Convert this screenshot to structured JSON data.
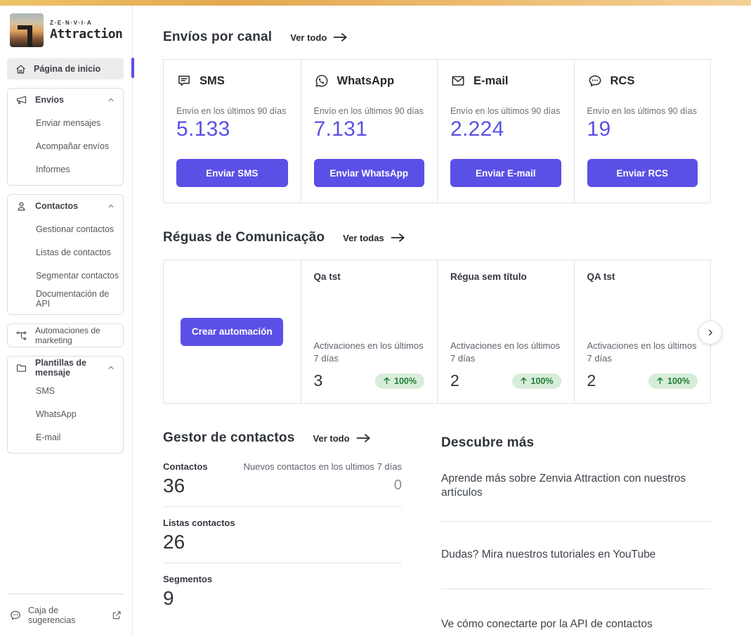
{
  "topbar": {
    "gradient": [
      "#eec369",
      "#e3a84f",
      "#ecba6e",
      "#f4d096"
    ]
  },
  "sidebar": {
    "logo": {
      "brand_small": "Z·E·N·V·I·A",
      "brand_large": "Attraction"
    },
    "home": {
      "label": "Página de inicio",
      "icon": "home-icon"
    },
    "groups": [
      {
        "label": "Envíos",
        "icon": "megaphone-icon",
        "children": [
          "Enviar mensajes",
          "Acompañar envíos",
          "Informes"
        ]
      },
      {
        "label": "Contactos",
        "icon": "person-icon",
        "children": [
          "Gestionar contactos",
          "Listas de contactos",
          "Segmentar contactos",
          "Documentación de API"
        ]
      },
      {
        "label": "Automaciones de marketing",
        "icon": "flow-branch-icon",
        "children": []
      },
      {
        "label": "Plantillas de mensaje",
        "icon": "folder-icon",
        "children": [
          "SMS",
          "WhatsApp",
          "E-mail"
        ]
      }
    ],
    "footer": {
      "label": "Caja de sugerencias",
      "icon": "chat-bubble-dots-icon",
      "action_icon": "external-link-icon"
    }
  },
  "channels": {
    "title": "Envíos por canal",
    "link_label": "Ver todo",
    "cards": [
      {
        "name": "SMS",
        "icon": "sms-message-icon",
        "metric_label": "Envío en los últimos 90 días",
        "value": "5.133",
        "button_label": "Enviar SMS"
      },
      {
        "name": "WhatsApp",
        "icon": "whatsapp-icon",
        "metric_label": "Envío en los últimos 90 días",
        "value": "7.131",
        "button_label": "Enviar WhatsApp"
      },
      {
        "name": "E-mail",
        "icon": "envelope-icon",
        "metric_label": "Envío en los últimos 90 días",
        "value": "2.224",
        "button_label": "Enviar E-mail"
      },
      {
        "name": "RCS",
        "icon": "chat-bubble-dots-icon",
        "metric_label": "Envío en los últimos 90 días",
        "value": "19",
        "button_label": "Enviar RCS"
      }
    ]
  },
  "rules": {
    "title": "Réguas de Comunicação",
    "link_label": "Ver todas",
    "create_button_label": "Crear automación",
    "cards": [
      {
        "name": "Qa tst",
        "metric_label": "Activaciones en los últimos 7 días",
        "value": "3",
        "delta": "100%"
      },
      {
        "name": "Régua sem título",
        "metric_label": "Activaciones en los últimos 7 días",
        "value": "2",
        "delta": "100%"
      },
      {
        "name": "QA tst",
        "metric_label": "Activaciones en los últimos 7 días",
        "value": "2",
        "delta": "100%"
      }
    ]
  },
  "contacts": {
    "title": "Gestor de contactos",
    "link_label": "Ver todo",
    "rows": [
      {
        "label": "Contactos",
        "value": "36",
        "secondary_label": "Nuevos contactos en los ultimos 7 días",
        "secondary_value": "0"
      },
      {
        "label": "Listas contactos",
        "value": "26"
      },
      {
        "label": "Segmentos",
        "value": "9"
      }
    ]
  },
  "discover": {
    "title": "Descubre más",
    "items": [
      {
        "label": "Aprende más sobre Zenvia Attraction con nuestros artículos"
      },
      {
        "label": "Dudas? Mira nuestros tutoriales en YouTube"
      },
      {
        "label": "Ve cómo conectarte por la API de contactos"
      }
    ]
  },
  "colors": {
    "accent": "#5a50e6",
    "badge_bg": "#d7edda",
    "badge_text": "#1f7d36",
    "number": "#5a50e6"
  }
}
